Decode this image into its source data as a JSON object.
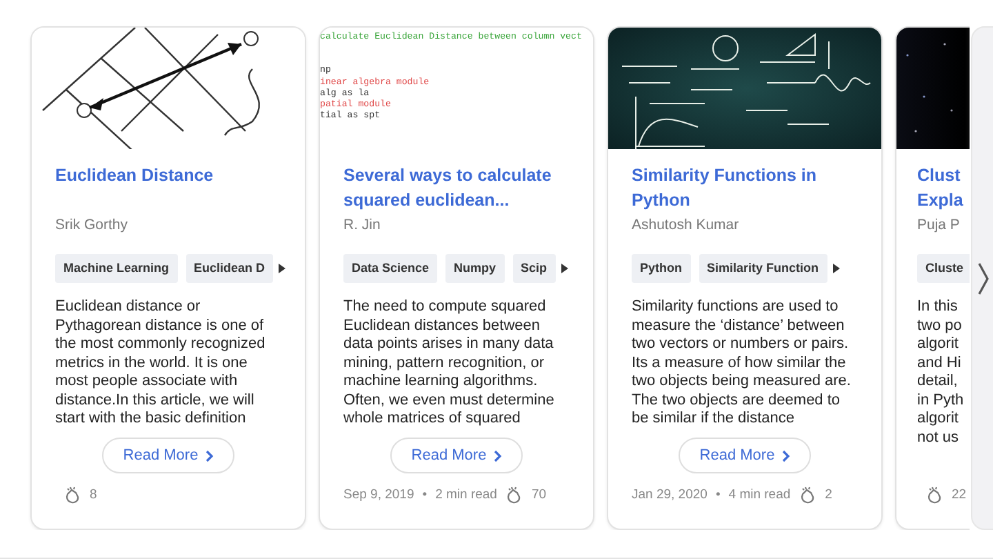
{
  "cards": [
    {
      "thumbnail": {
        "kind": "diagram"
      },
      "title": "Euclidean Distance",
      "author": "Srik Gorthy",
      "tags": [
        "Machine Learning",
        "Euclidean D"
      ],
      "tags_more": true,
      "body": "Euclidean distance or Pythagorean distance is one of the most commonly recognized metrics in the world. It is one most people associate with distance.In this article, we will start with the basic definition",
      "read_more": "Read More",
      "claps": "8"
    },
    {
      "thumbnail": {
        "kind": "code",
        "lines": [
          {
            "text": "calculate Euclidean Distance between column vect",
            "kind": "comment"
          },
          {
            "text": "np",
            "kind": "code"
          },
          {
            "text": "inear algebra module",
            "kind": "note"
          },
          {
            "text": "alg as la",
            "kind": "code"
          },
          {
            "text": "patial module",
            "kind": "note"
          },
          {
            "text": "tial as spt",
            "kind": "code"
          }
        ]
      },
      "title": "Several ways to calculate squared euclidean...",
      "author": "R. Jin",
      "tags": [
        "Data Science",
        "Numpy",
        "Scip"
      ],
      "tags_more": true,
      "body": "The need to compute squared Euclidean distances between data points arises in many data mining, pattern recognition, or machine learning algorithms. Often, we even must determine whole matrices of squared",
      "read_more": "Read More",
      "date": "Sep 9, 2019",
      "separator": "•",
      "read_time": "2 min read",
      "claps": "70"
    },
    {
      "thumbnail": {
        "kind": "picture"
      },
      "title": "Similarity Functions in Python",
      "author": "Ashutosh Kumar",
      "tags": [
        "Python",
        "Similarity Function"
      ],
      "tags_more": true,
      "body": "Similarity functions are used to measure the ‘distance’ between two vectors or numbers or pairs. Its a measure of how similar the two objects being measured are. The two objects are deemed to be similar if the distance",
      "read_more": "Read More",
      "date": "Jan 29, 2020",
      "separator": "•",
      "read_time": "4 min read",
      "claps": "2"
    },
    {
      "thumbnail": {
        "kind": "picture"
      },
      "title": "Clust\nExpla",
      "author": "Puja P",
      "tags": [
        "Cluste"
      ],
      "body": "In this\ntwo po\nalgorit\nand Hi\ndetail,\nin Pyth\nalgorit\nnot us",
      "claps": "22"
    }
  ]
}
